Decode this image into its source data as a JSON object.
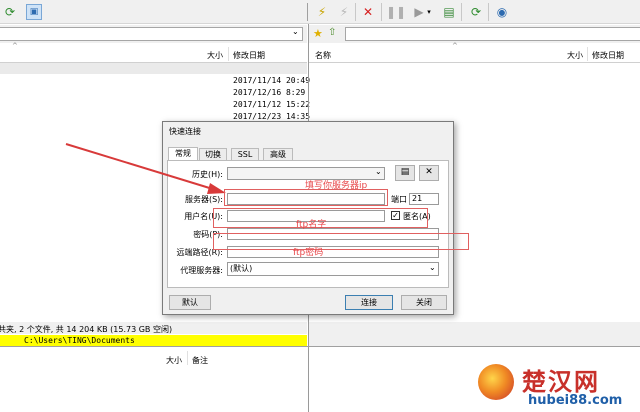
{
  "left_toolbar": {
    "icons": [
      "refresh-icon",
      "folder-view-icon"
    ]
  },
  "right_toolbar": {
    "icons": [
      "connect-icon",
      "disconnect-icon",
      "stop-icon",
      "pause-icon",
      "transfer-icon",
      "queue-icon",
      "refresh-icon",
      "site-icon"
    ]
  },
  "left_panel": {
    "address": "",
    "col_size": "大小",
    "col_date": "修改日期",
    "dates": [
      "2017/11/14 20:49",
      "2017/12/16 8:29",
      "2017/11/12 15:22",
      "2017/12/23 14:35"
    ]
  },
  "right_panel": {
    "address": "",
    "col_name": "名称",
    "col_size": "大小",
    "col_date": "修改日期"
  },
  "status": {
    "summary": "共夹, 2 个文件, 共 14 204 KB (15.73 GB 空闲)",
    "path": "C:\\Users\\TING\\Documents",
    "col_size": "大小",
    "col_note": "备注"
  },
  "dialog": {
    "title": "快速连接",
    "tabs": [
      "常规",
      "切换",
      "SSL",
      "高级"
    ],
    "labels": {
      "history": "历史(H):",
      "server": "服务器(S):",
      "port": "端口",
      "user": "用户名(U):",
      "anon": "匿名(A)",
      "password": "密码(P):",
      "remote": "远端路径(R):",
      "proxy": "代理服务器:"
    },
    "port_value": "21",
    "proxy_value": "(默认)",
    "buttons": {
      "default": "默认",
      "connect": "连接",
      "close": "关闭"
    }
  },
  "annotations": {
    "server": "填写你服务器ip",
    "user": "ftp名字",
    "password": "ftp密码"
  },
  "watermark": {
    "cn": "楚汉网",
    "url": "hubei88.com"
  },
  "colors": {
    "accent_red": "#e8474a",
    "status_yellow": "#ffff00",
    "dialog_bg": "#f0f0f0"
  }
}
